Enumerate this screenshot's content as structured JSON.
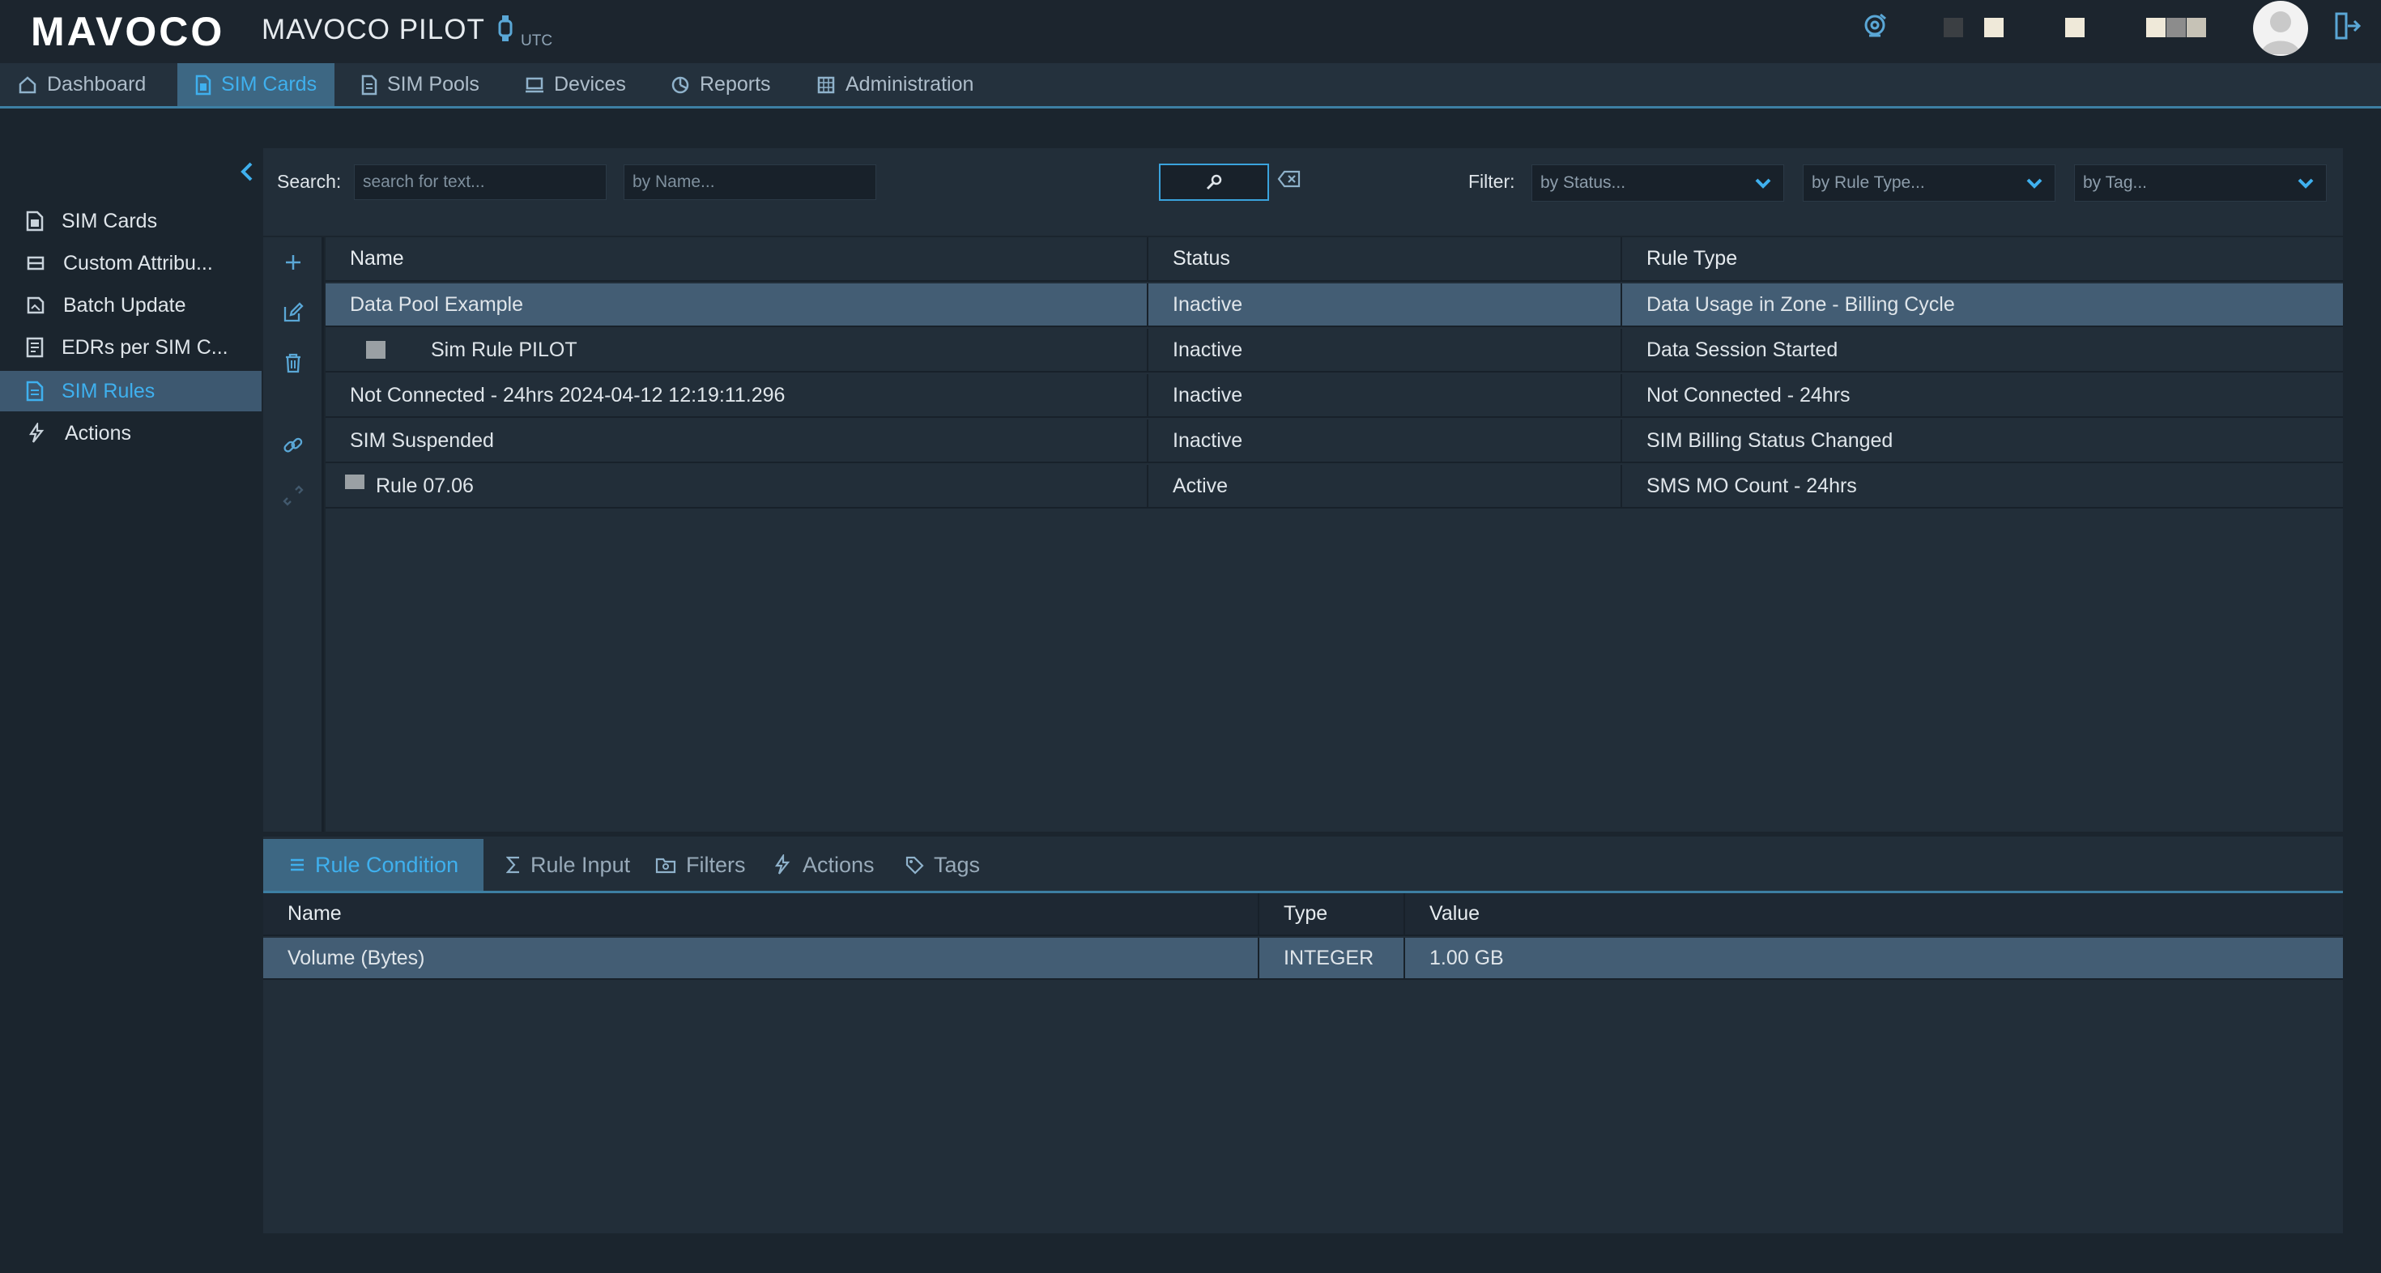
{
  "header": {
    "logo": "MAVOCO",
    "app_title": "MAVOCO PILOT",
    "timezone": "UTC"
  },
  "nav": {
    "tabs": [
      {
        "label": "Dashboard",
        "icon": "home-icon"
      },
      {
        "label": "SIM Cards",
        "icon": "sim-card-icon"
      },
      {
        "label": "SIM Pools",
        "icon": "sim-pool-icon"
      },
      {
        "label": "Devices",
        "icon": "device-icon"
      },
      {
        "label": "Reports",
        "icon": "reports-icon"
      },
      {
        "label": "Administration",
        "icon": "administration-icon"
      }
    ],
    "active": "SIM Cards"
  },
  "sidebar": {
    "items": [
      {
        "label": "SIM Cards",
        "icon": "sim-card-icon"
      },
      {
        "label": "Custom Attribu...",
        "icon": "custom-attributes-icon"
      },
      {
        "label": "Batch Update",
        "icon": "batch-update-icon"
      },
      {
        "label": "EDRs per SIM C...",
        "icon": "edr-icon"
      },
      {
        "label": "SIM Rules",
        "icon": "sim-rules-icon"
      },
      {
        "label": "Actions",
        "icon": "actions-icon"
      }
    ],
    "active": "SIM Rules"
  },
  "search": {
    "label": "Search:",
    "text_placeholder": "search for text...",
    "name_placeholder": "by Name...",
    "filter_label": "Filter:",
    "status_placeholder": "by Status...",
    "rule_type_placeholder": "by Rule Type...",
    "tag_placeholder": "by Tag..."
  },
  "rules_table": {
    "columns": [
      "Name",
      "Status",
      "Rule Type"
    ],
    "rows": [
      {
        "name": "Data Pool Example",
        "status": "Inactive",
        "rule_type": "Data Usage in Zone - Billing Cycle"
      },
      {
        "name": "Sim Rule PILOT",
        "status": "Inactive",
        "rule_type": "Data Session Started"
      },
      {
        "name": "Not Connected - 24hrs 2024-04-12 12:19:11.296",
        "status": "Inactive",
        "rule_type": "Not Connected - 24hrs"
      },
      {
        "name": "SIM Suspended",
        "status": "Inactive",
        "rule_type": "SIM Billing Status Changed"
      },
      {
        "name": "Rule 07.06",
        "status": "Active",
        "rule_type": "SMS MO Count - 24hrs"
      }
    ],
    "selected_row": 0
  },
  "detail_tabs": [
    {
      "label": "Rule Condition",
      "icon": "list-icon"
    },
    {
      "label": "Rule Input",
      "icon": "sigma-icon"
    },
    {
      "label": "Filters",
      "icon": "filter-icon"
    },
    {
      "label": "Actions",
      "icon": "actions-icon"
    },
    {
      "label": "Tags",
      "icon": "tag-icon"
    }
  ],
  "detail_table": {
    "columns": [
      "Name",
      "Type",
      "Value"
    ],
    "rows": [
      {
        "name": "Volume (Bytes)",
        "type": "INTEGER",
        "value": "1.00 GB"
      }
    ]
  },
  "colors": {
    "accent": "#3fb0ee",
    "background": "#1b252e",
    "panel": "#222e39",
    "selected_row": "#435d74"
  }
}
